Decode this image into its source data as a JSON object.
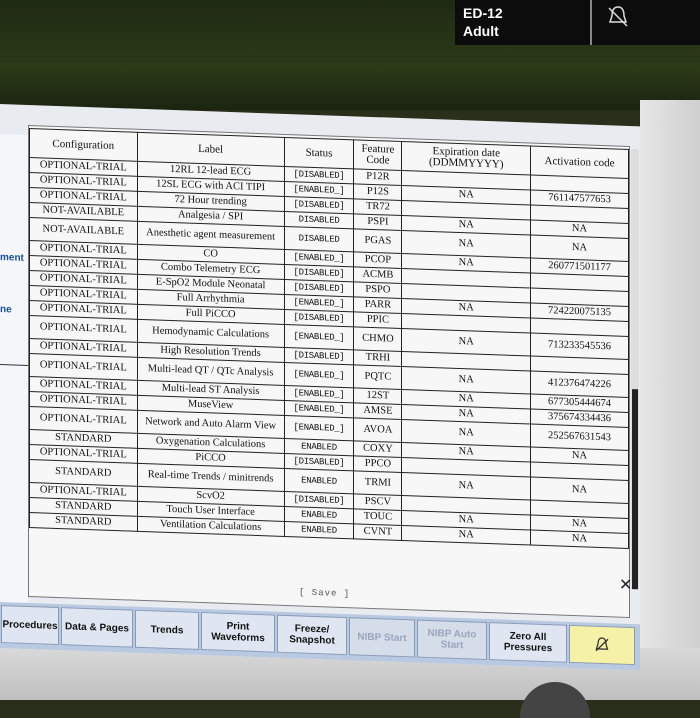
{
  "header": {
    "line1": "ED-12",
    "line2": "Adult"
  },
  "left_labels": [
    "ment",
    "ne"
  ],
  "table": {
    "headers": [
      "Configuration",
      "Label",
      "Status",
      "Feature Code",
      "Expiration date (DDMMYYYY)",
      "Activation code"
    ],
    "rows": [
      [
        "OPTIONAL-TRIAL",
        "12RL 12-lead ECG",
        "[DISABLED]",
        "P12R",
        "",
        ""
      ],
      [
        "OPTIONAL-TRIAL",
        "12SL ECG with ACI TIPI",
        "[ENABLED_]",
        "P12S",
        "NA",
        "761147577653"
      ],
      [
        "OPTIONAL-TRIAL",
        "72 Hour trending",
        "[DISABLED]",
        "TR72",
        "",
        ""
      ],
      [
        "NOT-AVAILABLE",
        "Analgesia / SPI",
        "DISABLED",
        "PSPI",
        "NA",
        "NA"
      ],
      [
        "NOT-AVAILABLE",
        "Anesthetic agent measurement",
        "DISABLED",
        "PGAS",
        "NA",
        "NA"
      ],
      [
        "OPTIONAL-TRIAL",
        "CO",
        "[ENABLED_]",
        "PCOP",
        "NA",
        "260771501177"
      ],
      [
        "OPTIONAL-TRIAL",
        "Combo Telemetry ECG",
        "[DISABLED]",
        "ACMB",
        "",
        ""
      ],
      [
        "OPTIONAL-TRIAL",
        "E-SpO2 Module Neonatal",
        "[DISABLED]",
        "PSPO",
        "",
        ""
      ],
      [
        "OPTIONAL-TRIAL",
        "Full Arrhythmia",
        "[ENABLED_]",
        "PARR",
        "NA",
        "724220075135"
      ],
      [
        "OPTIONAL-TRIAL",
        "Full PiCCO",
        "[DISABLED]",
        "PPIC",
        "",
        ""
      ],
      [
        "OPTIONAL-TRIAL",
        "Hemodynamic Calculations",
        "[ENABLED_]",
        "CHMO",
        "NA",
        "713233545536"
      ],
      [
        "OPTIONAL-TRIAL",
        "High Resolution Trends",
        "[DISABLED]",
        "TRHI",
        "",
        ""
      ],
      [
        "OPTIONAL-TRIAL",
        "Multi-lead QT / QTc Analysis",
        "[ENABLED_]",
        "PQTC",
        "NA",
        "412376474226"
      ],
      [
        "OPTIONAL-TRIAL",
        "Multi-lead ST Analysis",
        "[ENABLED_]",
        "12ST",
        "NA",
        "677305444674"
      ],
      [
        "OPTIONAL-TRIAL",
        "MuseView",
        "[ENABLED_]",
        "AMSE",
        "NA",
        "375674334436"
      ],
      [
        "OPTIONAL-TRIAL",
        "Network and Auto Alarm View",
        "[ENABLED_]",
        "AVOA",
        "NA",
        "252567631543"
      ],
      [
        "STANDARD",
        "Oxygenation Calculations",
        "ENABLED",
        "COXY",
        "NA",
        "NA"
      ],
      [
        "OPTIONAL-TRIAL",
        "PiCCO",
        "[DISABLED]",
        "PPCO",
        "",
        ""
      ],
      [
        "STANDARD",
        "Real-time Trends / minitrends",
        "ENABLED",
        "TRMI",
        "NA",
        "NA"
      ],
      [
        "OPTIONAL-TRIAL",
        "ScvO2",
        "[DISABLED]",
        "PSCV",
        "",
        ""
      ],
      [
        "STANDARD",
        "Touch User Interface",
        "ENABLED",
        "TOUC",
        "NA",
        "NA"
      ],
      [
        "STANDARD",
        "Ventilation Calculations",
        "ENABLED",
        "CVNT",
        "NA",
        "NA"
      ]
    ]
  },
  "save_label": "[ Save ]",
  "toolbar": [
    {
      "label": "Procedures",
      "disabled": false
    },
    {
      "label": "Data & Pages",
      "disabled": false
    },
    {
      "label": "Trends",
      "disabled": false
    },
    {
      "label": "Print Waveforms",
      "disabled": false
    },
    {
      "label": "Freeze/ Snapshot",
      "disabled": false
    },
    {
      "label": "NIBP Start",
      "disabled": true
    },
    {
      "label": "NIBP Auto Start",
      "disabled": true
    },
    {
      "label": "Zero All Pressures",
      "disabled": false
    },
    {
      "label": "",
      "icon": "alarm-silence-icon",
      "disabled": false
    }
  ]
}
